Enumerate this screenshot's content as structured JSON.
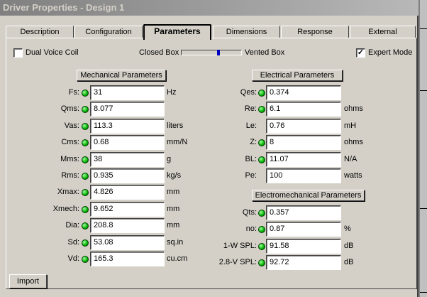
{
  "window": {
    "title": "Driver Properties - Design 1"
  },
  "tabs": [
    {
      "label": "Description"
    },
    {
      "label": "Configuration"
    },
    {
      "label": "Parameters"
    },
    {
      "label": "Dimensions"
    },
    {
      "label": "Response"
    },
    {
      "label": "External"
    }
  ],
  "active_tab": "Parameters",
  "options": {
    "dual_voice_coil": {
      "label": "Dual Voice Coil",
      "checked": false
    },
    "closed_box_label": "Closed Box",
    "vented_box_label": "Vented Box",
    "box_slider_value": 0.62,
    "expert_mode": {
      "label": "Expert Mode",
      "checked": true
    }
  },
  "mechanical": {
    "header": "Mechanical Parameters",
    "rows": [
      {
        "label": "Fs:",
        "value": "31",
        "unit": "Hz"
      },
      {
        "label": "Qms:",
        "value": "8.077",
        "unit": ""
      },
      {
        "label": "Vas:",
        "value": "113.3",
        "unit": "liters"
      },
      {
        "label": "Cms:",
        "value": "0.68",
        "unit": "mm/N"
      },
      {
        "label": "Mms:",
        "value": "38",
        "unit": "g"
      },
      {
        "label": "Rms:",
        "value": "0.935",
        "unit": "kg/s"
      },
      {
        "label": "Xmax:",
        "value": "4.826",
        "unit": "mm"
      },
      {
        "label": "Xmech:",
        "value": "9.652",
        "unit": "mm"
      },
      {
        "label": "Dia:",
        "value": "208.8",
        "unit": "mm"
      },
      {
        "label": "Sd:",
        "value": "53.08",
        "unit": "sq.in"
      },
      {
        "label": "Vd:",
        "value": "165.3",
        "unit": "cu.cm"
      }
    ]
  },
  "electrical": {
    "header": "Electrical Parameters",
    "rows": [
      {
        "label": "Qes:",
        "value": "0.374",
        "unit": "",
        "led": true
      },
      {
        "label": "Re:",
        "value": "6.1",
        "unit": "ohms",
        "led": true
      },
      {
        "label": "Le:",
        "value": "0.76",
        "unit": "mH",
        "led": false
      },
      {
        "label": "Z:",
        "value": "8",
        "unit": "ohms",
        "led": true
      },
      {
        "label": "BL:",
        "value": "11.07",
        "unit": "N/A",
        "led": true
      },
      {
        "label": "Pe:",
        "value": "100",
        "unit": "watts",
        "led": false
      }
    ]
  },
  "electromechanical": {
    "header": "Electromechanical Parameters",
    "rows": [
      {
        "label": "Qts:",
        "value": "0.357",
        "unit": ""
      },
      {
        "label": "no:",
        "value": "0.87",
        "unit": "%"
      },
      {
        "label": "1-W SPL:",
        "value": "91.58",
        "unit": "dB"
      },
      {
        "label": "2.8-V SPL:",
        "value": "92.72",
        "unit": "dB"
      }
    ]
  },
  "footer": {
    "import_label": "Import"
  }
}
